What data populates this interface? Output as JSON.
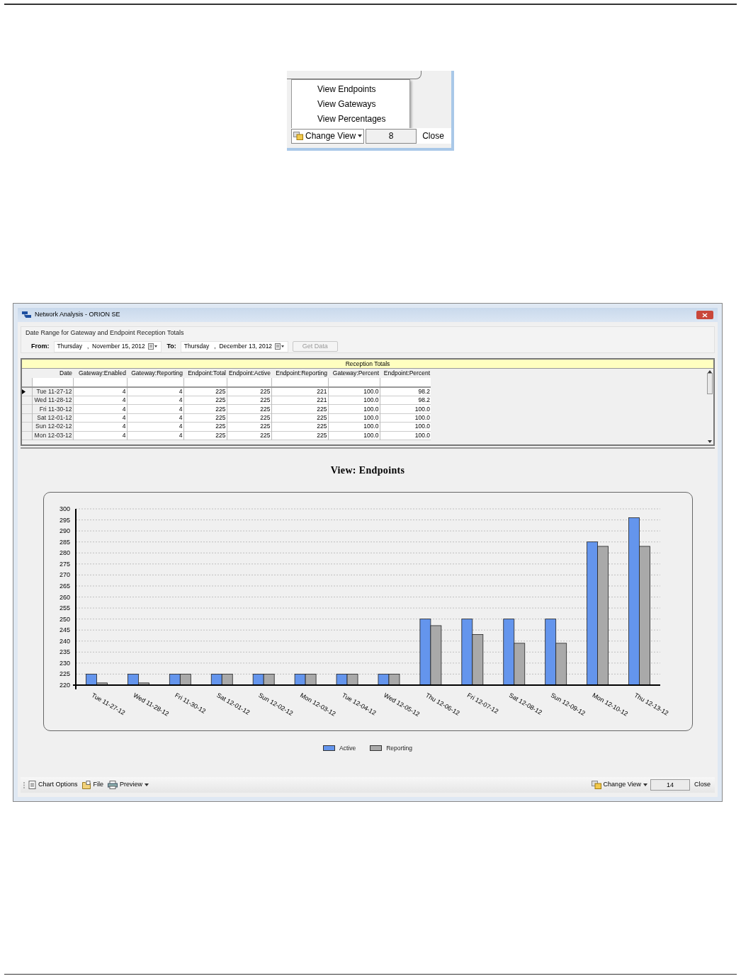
{
  "inset": {
    "menu_items": [
      {
        "label": "View Endpoints"
      },
      {
        "label": "View Gateways"
      },
      {
        "label": "View Percentages"
      }
    ],
    "change_view": "Change View",
    "count": "8",
    "close": "Close"
  },
  "window": {
    "title": "Network Analysis - ORION SE"
  },
  "date_range": {
    "label": "Date Range for Gateway and Endpoint Reception Totals",
    "from_label": "From:",
    "from_value": "Thursday   ,  November 15, 2012",
    "to_label": "To:",
    "to_value": "Thursday   ,  December 13, 2012",
    "get_data": "Get Data",
    "get_data_disabled": true
  },
  "table": {
    "title": "Reception Totals",
    "columns": [
      "Date",
      "Gateway:Enabled",
      "Gateway:Reporting",
      "Endpoint:Total",
      "Endpoint:Active",
      "Endpoint:Reporting",
      "Gateway:Percent",
      "Endpoint:Percent"
    ],
    "rows": [
      {
        "selected": true,
        "cells": [
          "Tue 11-27-12",
          "4",
          "4",
          "225",
          "225",
          "221",
          "100.0",
          "98.2"
        ]
      },
      {
        "selected": false,
        "cells": [
          "Wed 11-28-12",
          "4",
          "4",
          "225",
          "225",
          "221",
          "100.0",
          "98.2"
        ]
      },
      {
        "selected": false,
        "cells": [
          "Fri 11-30-12",
          "4",
          "4",
          "225",
          "225",
          "225",
          "100.0",
          "100.0"
        ]
      },
      {
        "selected": false,
        "cells": [
          "Sat 12-01-12",
          "4",
          "4",
          "225",
          "225",
          "225",
          "100.0",
          "100.0"
        ]
      },
      {
        "selected": false,
        "cells": [
          "Sun 12-02-12",
          "4",
          "4",
          "225",
          "225",
          "225",
          "100.0",
          "100.0"
        ]
      },
      {
        "selected": false,
        "cells": [
          "Mon 12-03-12",
          "4",
          "4",
          "225",
          "225",
          "225",
          "100.0",
          "100.0"
        ]
      }
    ]
  },
  "chart": {
    "chart_data": {
      "type": "bar",
      "title": "View: Endpoints",
      "categories": [
        "Tue 11-27-12",
        "Wed 11-28-12",
        "Fri 11-30-12",
        "Sat 12-01-12",
        "Sun 12-02-12",
        "Mon 12-03-12",
        "Tue 12-04-12",
        "Wed 12-05-12",
        "Thu 12-06-12",
        "Fri 12-07-12",
        "Sat 12-08-12",
        "Sun 12-09-12",
        "Mon 12-10-12",
        "Thu 12-13-12"
      ],
      "series": [
        {
          "name": "Active",
          "color": "#6495ed",
          "values": [
            225,
            225,
            225,
            225,
            225,
            225,
            225,
            225,
            250,
            250,
            250,
            250,
            285,
            296
          ]
        },
        {
          "name": "Reporting",
          "color": "#a9a9a9",
          "values": [
            221,
            221,
            225,
            225,
            225,
            225,
            225,
            225,
            247,
            243,
            239,
            239,
            283,
            283
          ]
        }
      ],
      "grid": true,
      "ylim": [
        220,
        300
      ],
      "yticks": [
        220,
        225,
        230,
        235,
        240,
        245,
        250,
        255,
        260,
        265,
        270,
        275,
        280,
        285,
        290,
        295,
        300
      ]
    }
  },
  "toolbar": {
    "items": [
      {
        "label": "Chart Options",
        "kind": "doc"
      },
      {
        "label": "File",
        "kind": "folder"
      },
      {
        "label": "Preview",
        "kind": "printer"
      }
    ],
    "change_view": "Change View",
    "count": "14",
    "close": "Close"
  }
}
